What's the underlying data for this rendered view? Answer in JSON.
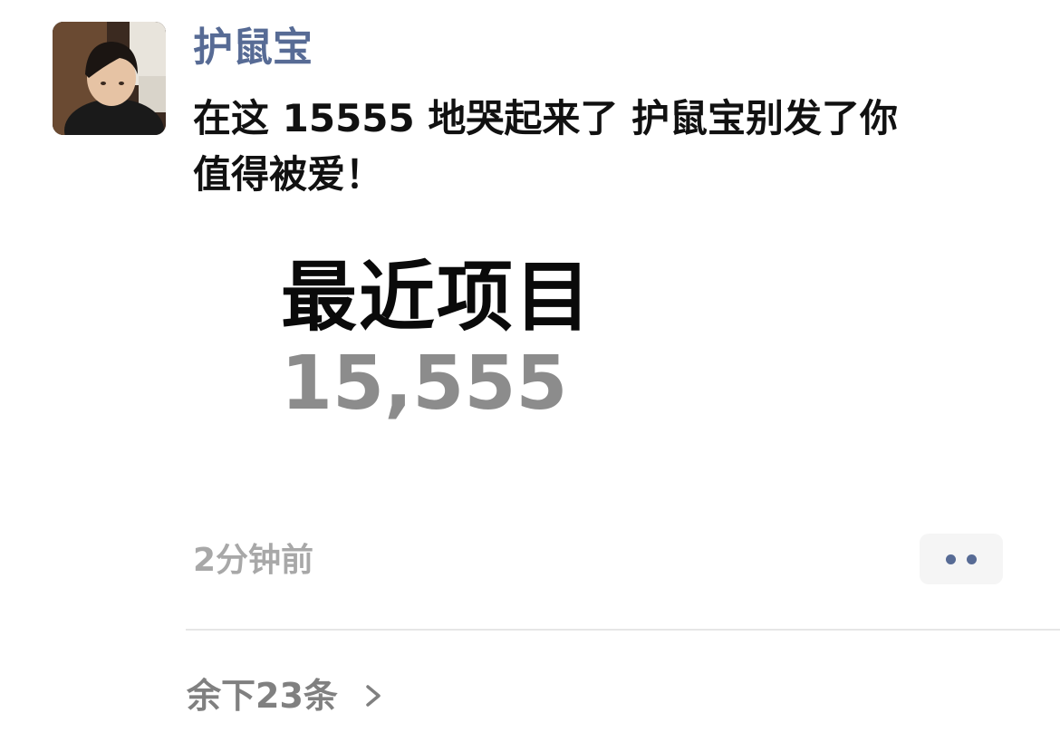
{
  "post": {
    "author": "护鼠宝",
    "text_line1": "在这 15555 地哭起来了 护鼠宝别发了你",
    "text_line2": "值得被爱！",
    "timestamp": "2分钟前"
  },
  "image": {
    "title": "最近项目",
    "count": "15,555"
  },
  "footer": {
    "remaining_label": "余下23条"
  },
  "icons": {
    "more": "more-dots-icon",
    "chevron": "chevron-right-icon"
  },
  "colors": {
    "author_link": "#576b95",
    "text": "#111111",
    "muted": "#a8a8a8",
    "more_bg": "#f5f5f5"
  }
}
